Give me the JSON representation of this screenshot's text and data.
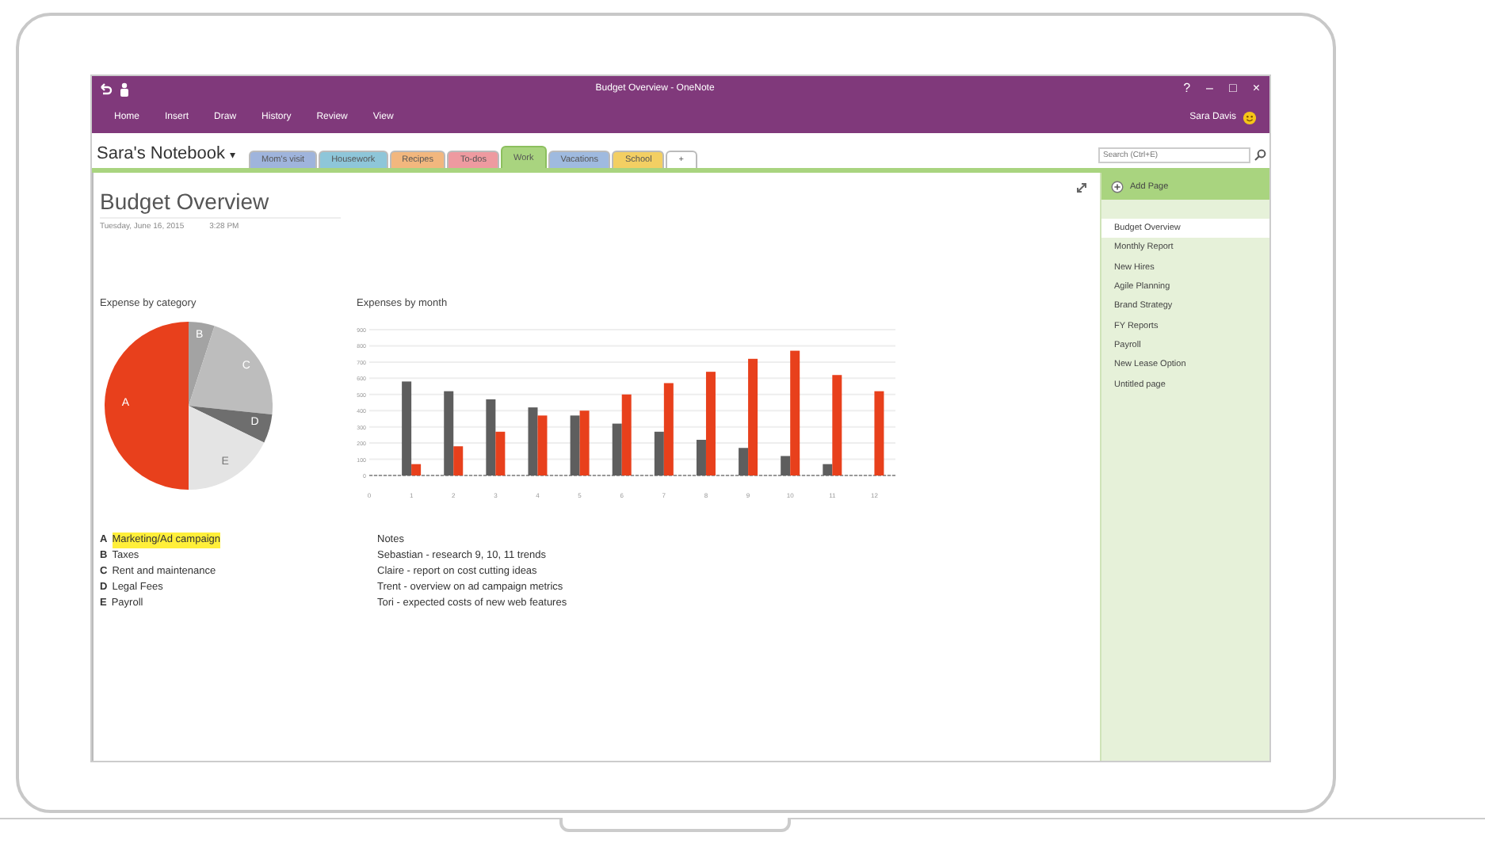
{
  "window": {
    "title": "Budget Overview - OneNote",
    "user": "Sara Davis",
    "controls": [
      "?",
      "–",
      "□",
      "×"
    ]
  },
  "ribbon_tabs": [
    "Home",
    "Insert",
    "Draw",
    "History",
    "Review",
    "View"
  ],
  "notebook": {
    "name": "Sara's Notebook",
    "caret": "▾"
  },
  "section_tabs": [
    {
      "label": "Mom's visit",
      "color": "#9fb4dc",
      "selected": false
    },
    {
      "label": "Housework",
      "color": "#8ec6d9",
      "selected": false
    },
    {
      "label": "Recipes",
      "color": "#f2b77e",
      "selected": false
    },
    {
      "label": "To-dos",
      "color": "#ee9aa0",
      "selected": false
    },
    {
      "label": "Work",
      "color": "#a9d47f",
      "selected": true
    },
    {
      "label": "Vacations",
      "color": "#9fbadf",
      "selected": false
    },
    {
      "label": "School",
      "color": "#f3cf63",
      "selected": false
    }
  ],
  "add_section": "+",
  "search": {
    "placeholder": "Search (Ctrl+E)"
  },
  "page": {
    "title": "Budget Overview",
    "date": "Tuesday, June 16, 2015",
    "time": "3:28 PM"
  },
  "pie": {
    "title": "Expense by category",
    "slices": [
      {
        "label": "A",
        "color": "#e8401c"
      },
      {
        "label": "B",
        "color": "#a3a3a3"
      },
      {
        "label": "C",
        "color": "#bdbdbd"
      },
      {
        "label": "D",
        "color": "#6e6e6e"
      },
      {
        "label": "E",
        "color": "#e4e4e4"
      }
    ]
  },
  "legend": [
    {
      "letter": "A",
      "label": "Marketing/Ad campaign",
      "highlighted": true
    },
    {
      "letter": "B",
      "label": "Taxes",
      "highlighted": false
    },
    {
      "letter": "C",
      "label": "Rent and maintenance",
      "highlighted": false
    },
    {
      "letter": "D",
      "label": "Legal Fees",
      "highlighted": false
    },
    {
      "letter": "E",
      "label": "Payroll",
      "highlighted": false
    }
  ],
  "bar_chart": {
    "chart_data": {
      "type": "bar",
      "title": "Expenses by month",
      "x": [
        1,
        2,
        3,
        4,
        5,
        6,
        7,
        8,
        9,
        10,
        11,
        12
      ],
      "series": [
        {
          "color": "#5e5e5e",
          "values": [
            580,
            520,
            470,
            420,
            370,
            320,
            270,
            220,
            170,
            120,
            70,
            null
          ]
        },
        {
          "color": "#e8401c",
          "values": [
            70,
            180,
            270,
            370,
            400,
            500,
            570,
            640,
            720,
            770,
            620,
            520
          ]
        }
      ],
      "xticks": [
        0,
        1,
        2,
        3,
        4,
        5,
        6,
        7,
        8,
        9,
        10,
        11,
        12
      ],
      "xlim": [
        0,
        12.5
      ],
      "grid": true,
      "yticks": [
        0,
        100,
        200,
        300,
        400,
        500,
        600,
        700,
        800,
        900
      ],
      "ylim": [
        0,
        900
      ]
    }
  },
  "notes": [
    "Notes",
    "Sebastian - research 9, 10, 11 trends",
    "Claire - report on cost cutting ideas",
    "Trent - overview on ad campaign metrics",
    "Tori - expected costs of new web features"
  ],
  "pages_panel": {
    "add_page": "Add Page",
    "pages": [
      {
        "title": "Budget Overview",
        "selected": true
      },
      {
        "title": "Monthly Report",
        "selected": false
      },
      {
        "title": "New Hires",
        "selected": false
      },
      {
        "title": "Agile Planning",
        "selected": false
      },
      {
        "title": "Brand Strategy",
        "selected": false
      },
      {
        "title": "FY Reports",
        "selected": false
      },
      {
        "title": "Payroll",
        "selected": false
      },
      {
        "title": "New Lease Option",
        "selected": false
      },
      {
        "title": "Untitled page",
        "selected": false
      }
    ]
  }
}
